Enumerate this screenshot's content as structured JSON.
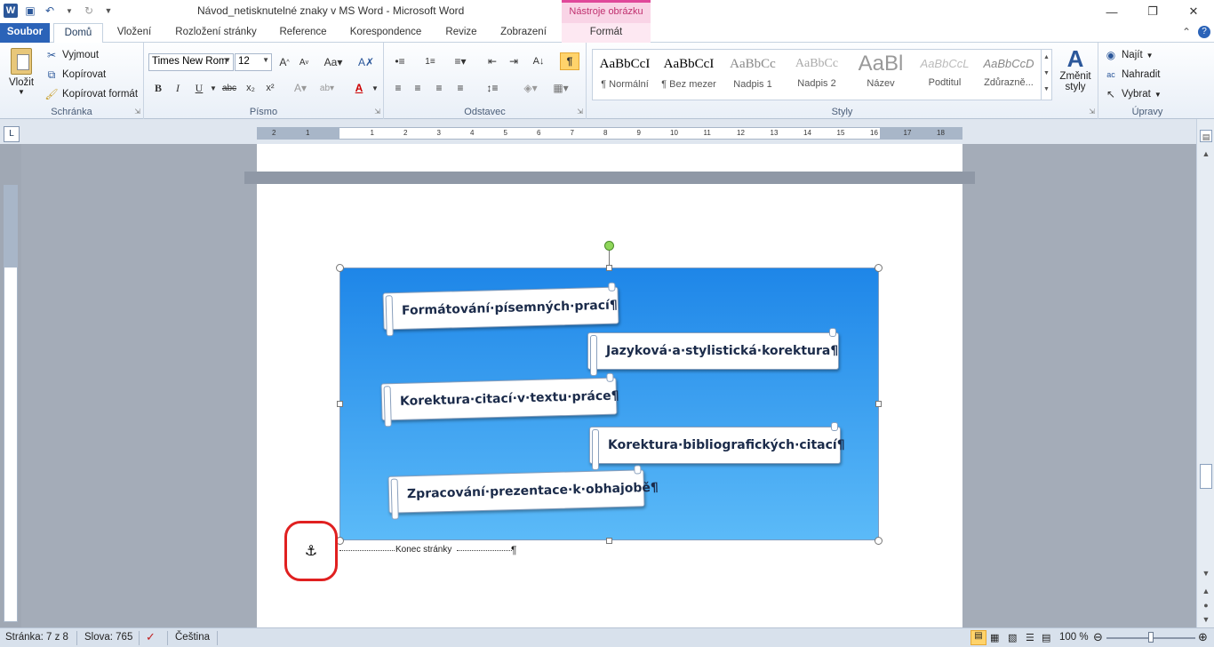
{
  "window": {
    "title": "Návod_netisknutelné znaky v MS Word  -  Microsoft Word",
    "context_tab_group": "Nástroje obrázku"
  },
  "tabs": {
    "file": "Soubor",
    "items": [
      "Domů",
      "Vložení",
      "Rozložení stránky",
      "Reference",
      "Korespondence",
      "Revize",
      "Zobrazení",
      "Formát"
    ]
  },
  "ribbon": {
    "clipboard": {
      "label": "Schránka",
      "paste": "Vložit",
      "cut": "Vyjmout",
      "copy": "Kopírovat",
      "format_painter": "Kopírovat formát"
    },
    "font": {
      "label": "Písmo",
      "font_name": "Times New Rom",
      "font_size": "12"
    },
    "paragraph": {
      "label": "Odstavec"
    },
    "styles": {
      "label": "Styly",
      "items": [
        {
          "sample": "AaBbCcI",
          "name": "¶ Normální"
        },
        {
          "sample": "AaBbCcI",
          "name": "¶ Bez mezer"
        },
        {
          "sample": "AaBbCc",
          "name": "Nadpis 1"
        },
        {
          "sample": "AaBbCc",
          "name": "Nadpis 2"
        },
        {
          "sample": "AaBl",
          "name": "Název"
        },
        {
          "sample": "AaBbCcL",
          "name": "Podtitul"
        },
        {
          "sample": "AaBbCcD",
          "name": "Zdůrazně..."
        }
      ],
      "change_styles_1": "Změnit",
      "change_styles_2": "styly"
    },
    "editing": {
      "label": "Úpravy",
      "find": "Najít",
      "replace": "Nahradit",
      "select": "Vybrat"
    }
  },
  "ruler": {
    "corner": "L",
    "labels": [
      "2",
      "1",
      "1",
      "2",
      "3",
      "4",
      "5",
      "6",
      "7",
      "8",
      "9",
      "10",
      "11",
      "12",
      "13",
      "14",
      "15",
      "16",
      "17",
      "18"
    ]
  },
  "document": {
    "smartart_items": [
      "Formátování·písemných·prací¶",
      "Jazyková·a·stylistická·korektura¶",
      "Korektura·citací·v·textu·práce¶",
      "Korektura·bibliografických·citací¶",
      "Zpracování·prezentace·k·obhajobě¶"
    ],
    "page_break": "Konec stránky",
    "pilcrow": "¶"
  },
  "status": {
    "page": "Stránka: 7 z 8",
    "words": "Slova: 765",
    "language": "Čeština",
    "zoom": "100 %"
  },
  "colors": {
    "accent": "#2b579a",
    "smartart_top": "#1e86e8",
    "smartart_bottom": "#5bbaf8",
    "highlight_circle": "#e02020"
  }
}
